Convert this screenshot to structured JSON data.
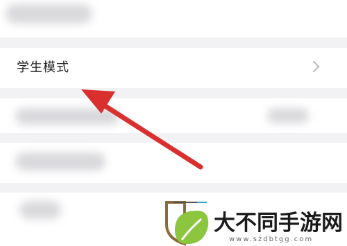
{
  "settings_list": {
    "student_mode": {
      "label": "学生模式",
      "chevron_icon": "chevron-right-icon"
    }
  },
  "annotation": {
    "arrow_icon": "red-arrow-pointer-icon",
    "color": "#d9302f"
  },
  "watermark": {
    "logo_icon": "leaf-shield-logo-icon",
    "text": "大不同手游网",
    "url": "www.szdbtgg.com"
  }
}
